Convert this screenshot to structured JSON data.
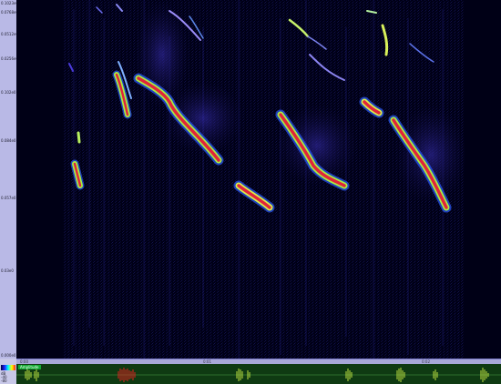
{
  "freq_axis": {
    "ticks": [
      "0.1023e0",
      "0.0768e0",
      "0.0512e0",
      "0.0256e0",
      "0.102e0",
      "0.084e0",
      "0.057e0",
      "0.03e0",
      "0.000e0"
    ]
  },
  "time_axis": {
    "labels": [
      "0:00",
      "0:01",
      "0:02"
    ]
  },
  "waveform": {
    "label": "Amplitude",
    "side_labels": [
      "dB",
      "-40",
      "-80"
    ]
  },
  "colors": {
    "background": "#000016",
    "low": "#2a2ad0",
    "mid": "#9fe04a",
    "high": "#d81d2b",
    "wave": "#bde040",
    "wave_selected": "#e02020"
  }
}
